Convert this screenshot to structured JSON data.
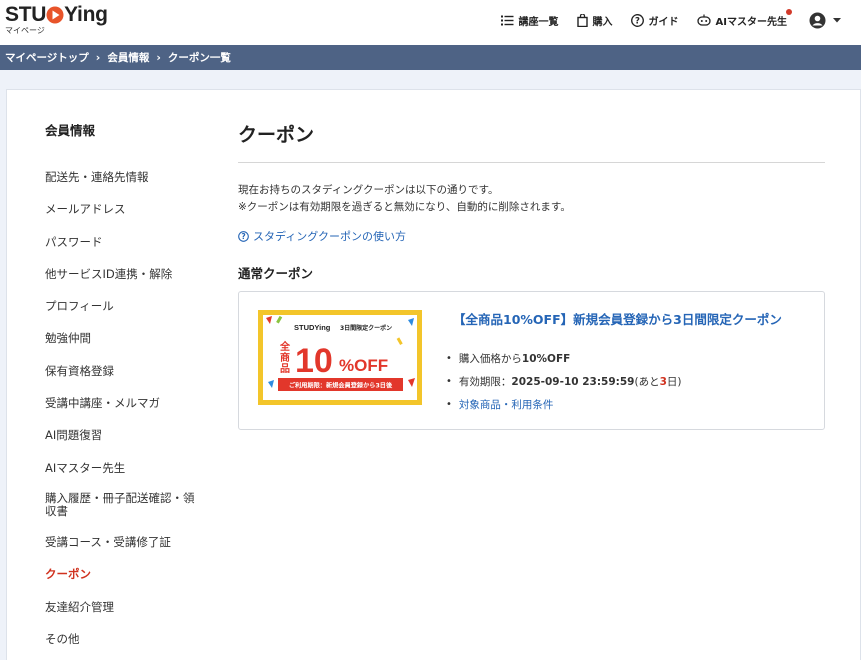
{
  "header": {
    "logo_main": "STU",
    "logo_main2": "Ying",
    "logo_sub": "マイページ",
    "nav": {
      "courses": "講座一覧",
      "purchase": "購入",
      "guide": "ガイド",
      "ai_master": "AIマスター先生"
    }
  },
  "breadcrumb": {
    "items": [
      "マイページトップ",
      "会員情報",
      "クーポン一覧"
    ],
    "separator": "›"
  },
  "sidebar": {
    "title": "会員情報",
    "items": [
      "配送先・連絡先情報",
      "メールアドレス",
      "パスワード",
      "他サービスID連携・解除",
      "プロフィール",
      "勉強仲間",
      "保有資格登録",
      "受講中講座・メルマガ",
      "AI問題復習",
      "AIマスター先生",
      "購入履歴・冊子配送確認・領収書",
      "受講コース・受講修了証",
      "クーポン",
      "友達紹介管理",
      "その他"
    ],
    "active_index": 12
  },
  "main": {
    "title": "クーポン",
    "desc_line1": "現在お持ちのスタディングクーポンは以下の通りです。",
    "desc_line2": "※クーポンは有効期限を過ぎると無効になり、自動的に削除されます。",
    "howto_link": "スタディングクーポンの使い方",
    "section_title": "通常クーポン",
    "coupon": {
      "title": "【全商品10%OFF】新規会員登録から3日間限定クーポン",
      "discount_prefix": "購入価格から",
      "discount_value": "10%OFF",
      "expiry_prefix": "有効期限：",
      "expiry_value": "2025-09-10 23:59:59",
      "remaining_prefix": " (あと",
      "remaining_days": "3",
      "remaining_suffix": "日)",
      "terms_link": "対象商品・利用条件",
      "image": {
        "logo": "STUDYing",
        "tag": "3日間限定クーポン",
        "side_text": "全商品",
        "big": "10",
        "unit": "%OFF",
        "footer": "ご利用期限：新規会員登録から3日後"
      }
    }
  },
  "colors": {
    "breadcrumb_bg": "#4e6385",
    "link": "#2565b6",
    "active": "#d0321f",
    "coupon_border": "#f3c52a",
    "coupon_red": "#e2372b"
  }
}
